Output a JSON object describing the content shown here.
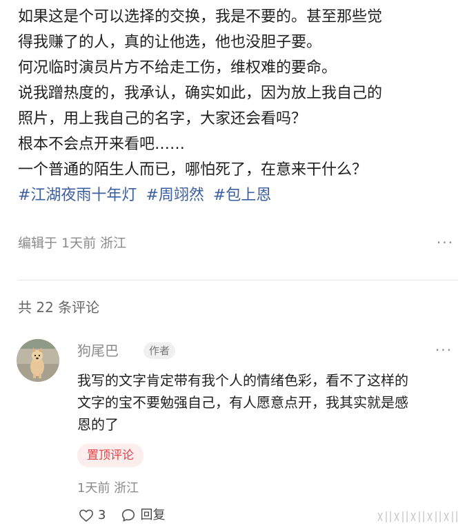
{
  "post": {
    "lines": [
      "如果这是个可以选择的交换，我是不要的。甚至那些觉",
      "得我赚了的人，真的让他选，他也没胆子要。",
      "何况临时演员片方不给走工伤，维权难的要命。",
      "说我蹭热度的，我承认，确实如此，因为放上我自己的",
      "照片，用上我自己的名字，大家还会看吗？",
      "根本不会点开来看吧……",
      "一个普通的陌生人而已，哪怕死了，在意来干什么？"
    ],
    "tags": [
      "#江湖夜雨十年灯",
      "#周翊然",
      "#包上恩"
    ],
    "meta": "编辑于 1天前 浙江",
    "more_label": "···"
  },
  "comments_count": "共 22 条评论",
  "comment": {
    "author": "狗尾巴",
    "author_badge": "作者",
    "more_label": "···",
    "lines": [
      "我写的文字肯定带有我个人的情绪色彩，看不了这样的",
      "文字的宝不要勉强自己，有人愿意点开，我其实就是感",
      "恩的了"
    ],
    "pin_label": "置顶评论",
    "meta": "1天前 浙江",
    "likes": "3",
    "reply_label": "回复",
    "icons": {
      "like": "heart-outline-icon",
      "reply": "speech-bubble-icon"
    }
  },
  "colors": {
    "tag": "#3a5f9e",
    "pin_text": "#e0424a",
    "pin_bg": "#fdeeee",
    "meta": "#8a8a8a"
  }
}
